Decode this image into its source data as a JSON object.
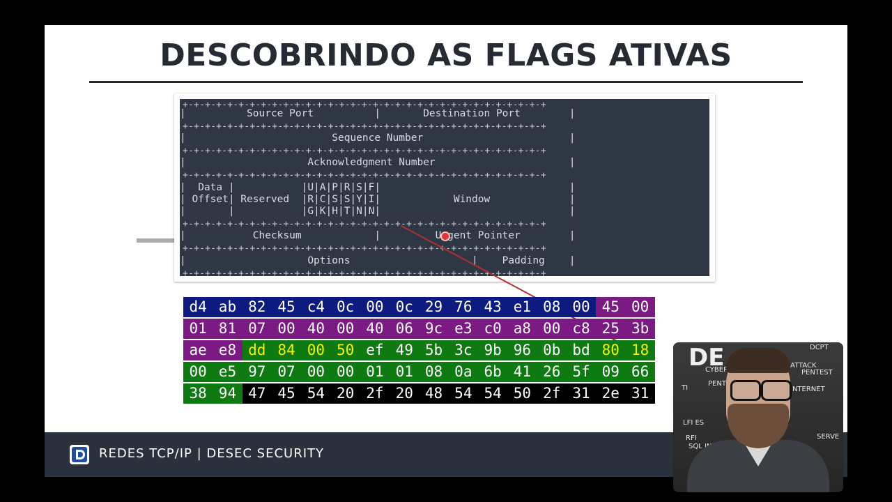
{
  "slide": {
    "title": "DESCOBRINDO AS FLAGS ATIVAS",
    "footer": "REDES TCP/IP | DESEC SECURITY"
  },
  "tcp_header": {
    "border_line": "+-+-+-+-+-+-+-+-+-+-+-+-+-+-+-+-+-+-+-+-+-+-+-+-+-+-+-+-+-+-+-+-+",
    "row1": "|          Source Port          |       Destination Port        |",
    "row2": "|                        Sequence Number                        |",
    "row3": "|                    Acknowledgment Number                      |",
    "row4a": "|  Data |           |U|A|P|R|S|F|                               |",
    "row4b": "| Offset| Reserved  |R|C|S|S|Y|I|            Window             |",
    "row4c": "|       |           |G|K|H|T|N|N|                               |",
    "row5": "|           Checksum            |         Urgent Pointer        |",
    "row6": "|                    Options                    |    Padding    |"
  },
  "hex_rows": [
    [
      "d4",
      "ab",
      "82",
      "45",
      "c4",
      "0c",
      "00",
      "0c",
      "29",
      "76",
      "43",
      "e1",
      "08",
      "00",
      "45",
      "00"
    ],
    [
      "01",
      "81",
      "07",
      "00",
      "40",
      "00",
      "40",
      "06",
      "9c",
      "e3",
      "c0",
      "a8",
      "00",
      "c8",
      "25",
      "3b"
    ],
    [
      "ae",
      "e8",
      "dd",
      "84",
      "00",
      "50",
      "ef",
      "49",
      "5b",
      "3c",
      "9b",
      "96",
      "0b",
      "bd",
      "80",
      "18"
    ],
    [
      "00",
      "e5",
      "97",
      "07",
      "00",
      "00",
      "01",
      "01",
      "08",
      "0a",
      "6b",
      "41",
      "26",
      "5f",
      "09",
      "66"
    ],
    [
      "38",
      "94",
      "47",
      "45",
      "54",
      "20",
      "2f",
      "20",
      "48",
      "54",
      "54",
      "50",
      "2f",
      "31",
      "2e",
      "31"
    ]
  ],
  "colors": {
    "ethernet": "#0d1a80",
    "ip": "#7a1a82",
    "tcp": "#107a12",
    "payload": "#000000",
    "highlight_text": "#f5f500"
  }
}
